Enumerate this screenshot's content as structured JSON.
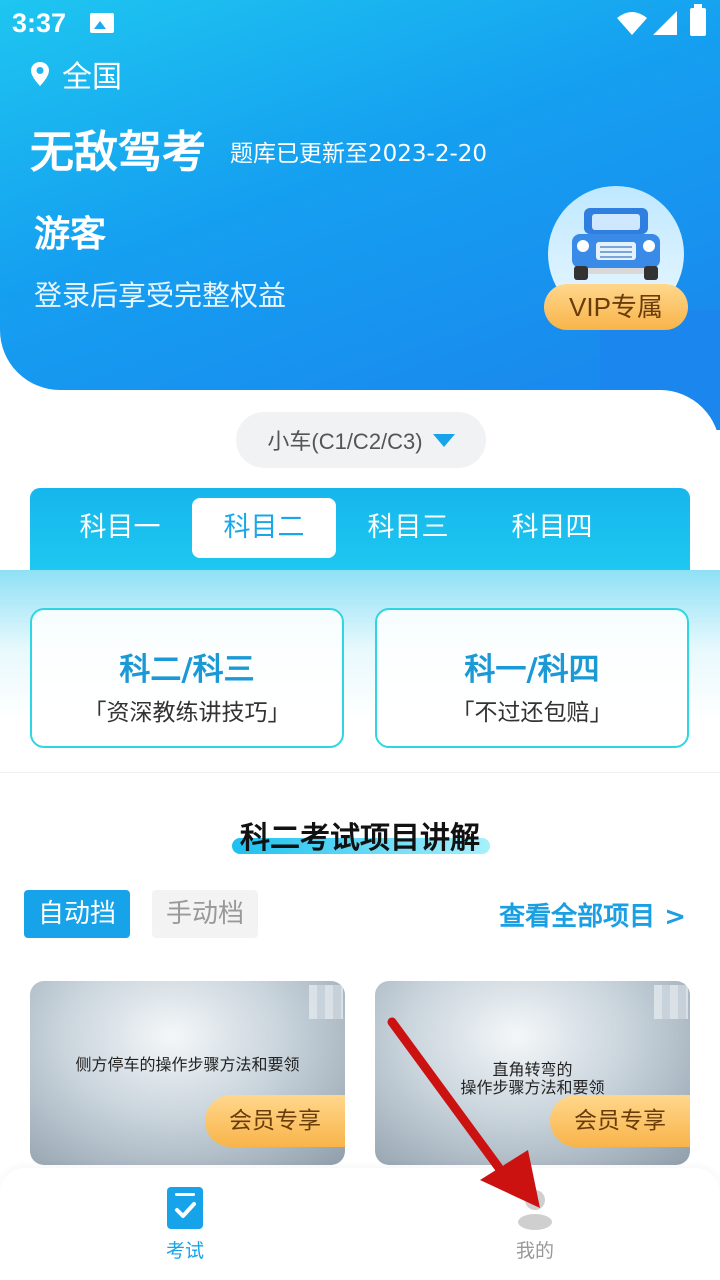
{
  "status_bar": {
    "time": "3:37"
  },
  "header": {
    "location": "全国",
    "app_title": "无敌驾考",
    "update_text": "题库已更新至2023-2-20",
    "guest_name": "游客",
    "login_hint": "登录后享受完整权益",
    "vip_label": "VIP专属"
  },
  "car_type": {
    "selected": "小车(C1/C2/C3)"
  },
  "tabs": [
    {
      "label": "科目一",
      "active": false
    },
    {
      "label": "科目二",
      "active": true
    },
    {
      "label": "科目三",
      "active": false
    },
    {
      "label": "科目四",
      "active": false
    }
  ],
  "promos": [
    {
      "title": "科二/科三",
      "subtitle": "「资深教练讲技巧」"
    },
    {
      "title": "科一/科四",
      "subtitle": "「不过还包赔」"
    }
  ],
  "section": {
    "title": "科二考试项目讲解",
    "gear_auto": "自动挡",
    "gear_manual": "手动档",
    "view_all": "查看全部项目 >"
  },
  "videos": [
    {
      "caption_line1": "侧方停车的操作步骤方法和要领",
      "caption_line2": "",
      "badge": "会员专享"
    },
    {
      "caption_line1": "直角转弯的",
      "caption_line2": "操作步骤方法和要领",
      "badge": "会员专享"
    }
  ],
  "bottom_nav": [
    {
      "label": "考试",
      "active": true
    },
    {
      "label": "我的",
      "active": false
    }
  ],
  "colors": {
    "primary": "#17a3ea",
    "gold": "#f8b44a",
    "arrow": "#cc1111"
  }
}
